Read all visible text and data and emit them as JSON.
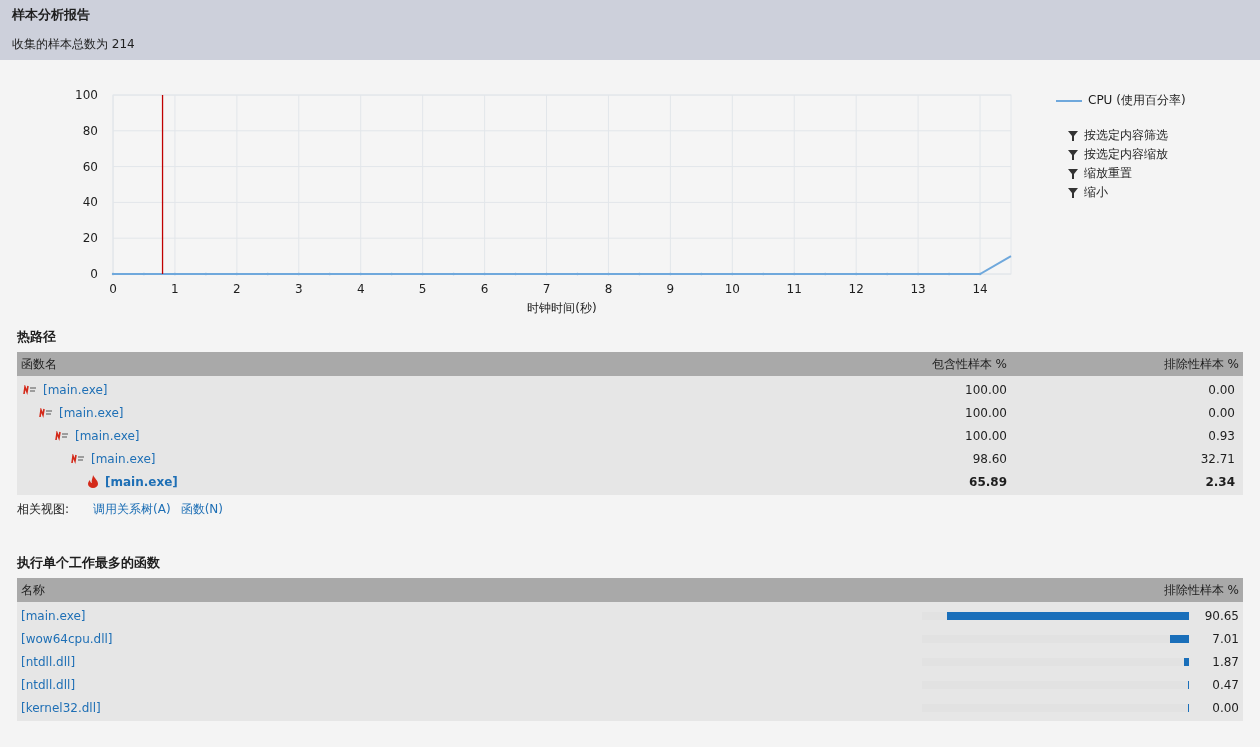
{
  "report": {
    "title": "样本分析报告",
    "summary": "收集的样本总数为 214"
  },
  "cpu_chart": {
    "chart_data": {
      "type": "line",
      "xlabel": "时钟时间(秒)",
      "x": [
        0,
        14,
        14.5
      ],
      "series": [
        {
          "name": "CPU (使用百分率)",
          "color": "#6fa8dc",
          "values": [
            0,
            0,
            10
          ]
        }
      ],
      "xlim": [
        0,
        14.5
      ],
      "ylim": [
        0,
        100
      ],
      "xticks": [
        0,
        1,
        2,
        3,
        4,
        5,
        6,
        7,
        8,
        9,
        10,
        11,
        12,
        13,
        14
      ],
      "yticks": [
        0,
        20,
        40,
        60,
        80,
        100
      ],
      "grid": true,
      "ref_lines": [
        {
          "axis": "x",
          "value": 0.8
        }
      ]
    },
    "filters": [
      "按选定内容筛选",
      "按选定内容缩放",
      "缩放重置",
      "缩小"
    ]
  },
  "hot_path": {
    "title": "热路径",
    "columns": [
      "函数名",
      "包含性样本 %",
      "排除性样本 %"
    ],
    "rows": [
      {
        "name": "[main.exe]",
        "inclusive": "100.00",
        "exclusive": "0.00",
        "hot": false,
        "children": [
          {
            "name": "[main.exe]",
            "inclusive": "100.00",
            "exclusive": "0.00",
            "hot": false,
            "children": [
              {
                "name": "[main.exe]",
                "inclusive": "100.00",
                "exclusive": "0.93",
                "hot": false,
                "children": [
                  {
                    "name": "[main.exe]",
                    "inclusive": "98.60",
                    "exclusive": "32.71",
                    "hot": false,
                    "children": [
                      {
                        "name": "[main.exe]",
                        "inclusive": "65.89",
                        "exclusive": "2.34",
                        "hot": true
                      }
                    ]
                  }
                ]
              }
            ]
          }
        ]
      }
    ],
    "related_label": "相关视图:",
    "related_links": [
      "调用关系树(A)",
      "函数(N)"
    ]
  },
  "top_functions": {
    "title": "执行单个工作最多的函数",
    "columns": [
      "名称",
      "排除性样本 %"
    ],
    "rows": [
      {
        "name": "[main.exe]",
        "level": 0.9065,
        "value": "90.65"
      },
      {
        "name": "[wow64cpu.dll]",
        "level": 0.0701,
        "value": "7.01"
      },
      {
        "name": "[ntdll.dll]",
        "level": 0.0187,
        "value": "1.87"
      },
      {
        "name": "[ntdll.dll]",
        "level": 0.0047,
        "value": "0.47"
      },
      {
        "name": "[kernel32.dll]",
        "level": 0,
        "value": "0.00"
      }
    ]
  }
}
